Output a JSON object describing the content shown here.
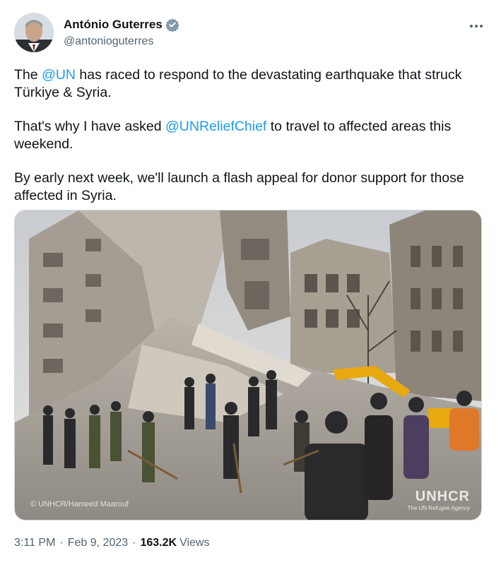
{
  "author": {
    "display_name": "António Guterres",
    "handle": "@antonioguterres"
  },
  "tweet": {
    "p1_pre": "The ",
    "p1_mention": "@UN",
    "p1_post": " has raced to respond to the devastating earthquake that struck Türkiye & Syria.",
    "p2_pre": "That's why I have asked ",
    "p2_mention": "@UNReliefChief",
    "p2_post": " to travel to affected areas this weekend.",
    "p3": "By early next week, we'll launch a flash appeal for donor support for those affected in Syria."
  },
  "media": {
    "credit": "© UNHCR/Hameed Maarouf",
    "watermark": "UNHCR",
    "watermark_sub": "The UN Refugee Agency"
  },
  "meta": {
    "time": "3:11 PM",
    "separator": "·",
    "date": "Feb 9, 2023",
    "views_count": "163.2K",
    "views_label": "Views"
  },
  "colors": {
    "link": "#1d9bf0",
    "secondary_text": "#536471",
    "primary_text": "#0f1419"
  },
  "icons": [
    "verified-badge-icon",
    "more-options-icon"
  ]
}
